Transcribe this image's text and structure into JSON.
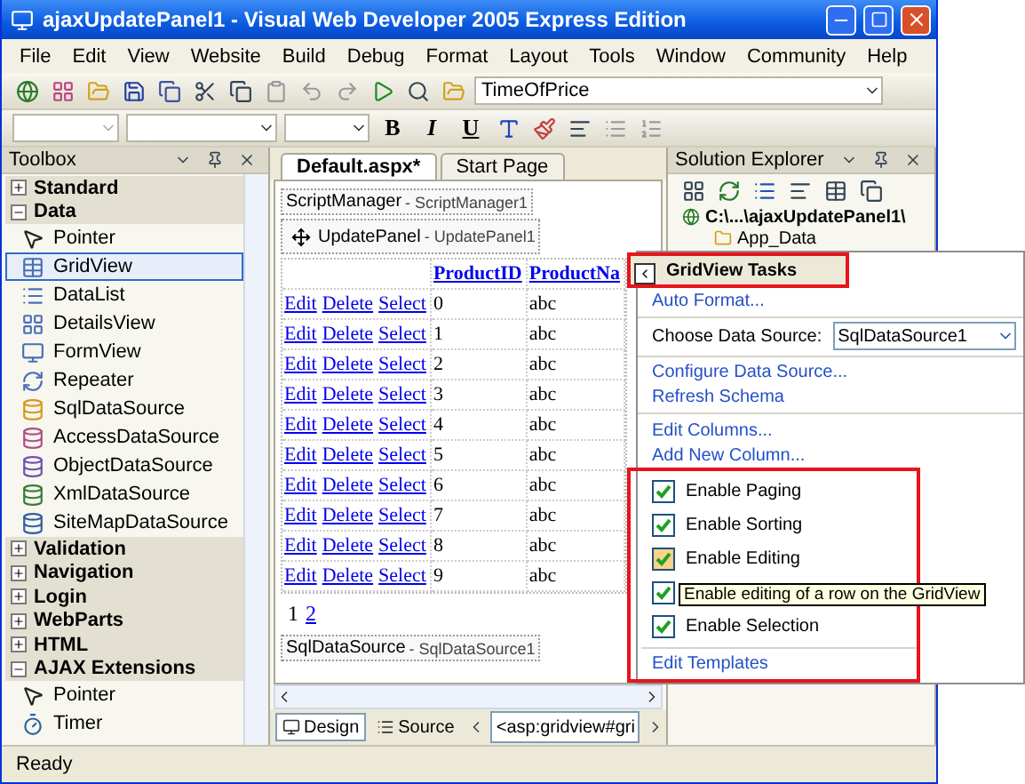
{
  "window": {
    "title": "ajaxUpdatePanel1 - Visual Web Developer 2005 Express Edition"
  },
  "menu": [
    "File",
    "Edit",
    "View",
    "Website",
    "Build",
    "Debug",
    "Format",
    "Layout",
    "Tools",
    "Window",
    "Community",
    "Help"
  ],
  "toolbar": {
    "combo_value": "TimeOfPrice"
  },
  "format_toolbar": {
    "buttons": [
      "B",
      "I",
      "U"
    ]
  },
  "toolbox": {
    "title": "Toolbox",
    "sections": [
      {
        "label": "Standard",
        "expanded": false
      },
      {
        "label": "Data",
        "expanded": true,
        "children": [
          {
            "label": "Pointer",
            "selected": false
          },
          {
            "label": "GridView",
            "selected": true
          },
          {
            "label": "DataList",
            "selected": false
          },
          {
            "label": "DetailsView",
            "selected": false
          },
          {
            "label": "FormView",
            "selected": false
          },
          {
            "label": "Repeater",
            "selected": false
          },
          {
            "label": "SqlDataSource",
            "selected": false
          },
          {
            "label": "AccessDataSource",
            "selected": false
          },
          {
            "label": "ObjectDataSource",
            "selected": false
          },
          {
            "label": "XmlDataSource",
            "selected": false
          },
          {
            "label": "SiteMapDataSource",
            "selected": false
          }
        ]
      },
      {
        "label": "Validation",
        "expanded": false
      },
      {
        "label": "Navigation",
        "expanded": false
      },
      {
        "label": "Login",
        "expanded": false
      },
      {
        "label": "WebParts",
        "expanded": false
      },
      {
        "label": "HTML",
        "expanded": false
      },
      {
        "label": "AJAX Extensions",
        "expanded": true,
        "children": [
          {
            "label": "Pointer",
            "selected": false
          },
          {
            "label": "Timer",
            "selected": false
          }
        ]
      }
    ]
  },
  "document": {
    "tabs": [
      {
        "label": "Default.aspx*",
        "selected": true
      },
      {
        "label": "Start Page",
        "selected": false
      }
    ],
    "script_manager": {
      "type": "ScriptManager",
      "id": " - ScriptManager1"
    },
    "update_panel": {
      "type": "UpdatePanel",
      "id": " - UpdatePanel1"
    },
    "grid": {
      "columns": [
        "ProductID",
        "ProductNa"
      ],
      "rows": [
        {
          "actions": [
            "Edit",
            "Delete",
            "Select"
          ],
          "id": "0",
          "name": "abc"
        },
        {
          "actions": [
            "Edit",
            "Delete",
            "Select"
          ],
          "id": "1",
          "name": "abc"
        },
        {
          "actions": [
            "Edit",
            "Delete",
            "Select"
          ],
          "id": "2",
          "name": "abc"
        },
        {
          "actions": [
            "Edit",
            "Delete",
            "Select"
          ],
          "id": "3",
          "name": "abc"
        },
        {
          "actions": [
            "Edit",
            "Delete",
            "Select"
          ],
          "id": "4",
          "name": "abc"
        },
        {
          "actions": [
            "Edit",
            "Delete",
            "Select"
          ],
          "id": "5",
          "name": "abc"
        },
        {
          "actions": [
            "Edit",
            "Delete",
            "Select"
          ],
          "id": "6",
          "name": "abc"
        },
        {
          "actions": [
            "Edit",
            "Delete",
            "Select"
          ],
          "id": "7",
          "name": "abc"
        },
        {
          "actions": [
            "Edit",
            "Delete",
            "Select"
          ],
          "id": "8",
          "name": "abc"
        },
        {
          "actions": [
            "Edit",
            "Delete",
            "Select"
          ],
          "id": "9",
          "name": "abc"
        }
      ],
      "pager": [
        {
          "label": "1",
          "selected": true
        },
        {
          "label": "2",
          "selected": false
        }
      ]
    },
    "data_source": {
      "type": "SqlDataSource",
      "id": " - SqlDataSource1"
    },
    "view_tabs": [
      {
        "label": "Design",
        "selected": true
      },
      {
        "label": "Source",
        "selected": false
      }
    ],
    "breadcrumb": "<asp:gridview#gri"
  },
  "solution_explorer": {
    "title": "Solution Explorer",
    "root": "C:\\...\\ajaxUpdatePanel1\\",
    "children": [
      "App_Data"
    ]
  },
  "tasks": {
    "title": "GridView Tasks",
    "auto_format": "Auto Format...",
    "data_source_label": "Choose Data Source:",
    "data_source_value": "SqlDataSource1",
    "links": [
      "Configure Data Source...",
      "Refresh Schema"
    ],
    "column_links": [
      "Edit Columns...",
      "Add New Column..."
    ],
    "options": [
      {
        "label": "Enable Paging",
        "checked": true
      },
      {
        "label": "Enable Sorting",
        "checked": true
      },
      {
        "label": "Enable Editing",
        "checked": true
      },
      {
        "checked": true,
        "tooltip": "Enable editing of a row on the GridView"
      },
      {
        "label": "Enable Selection",
        "checked": true
      }
    ],
    "edit_templates": "Edit Templates"
  },
  "status_bar": {
    "text": "Ready"
  }
}
